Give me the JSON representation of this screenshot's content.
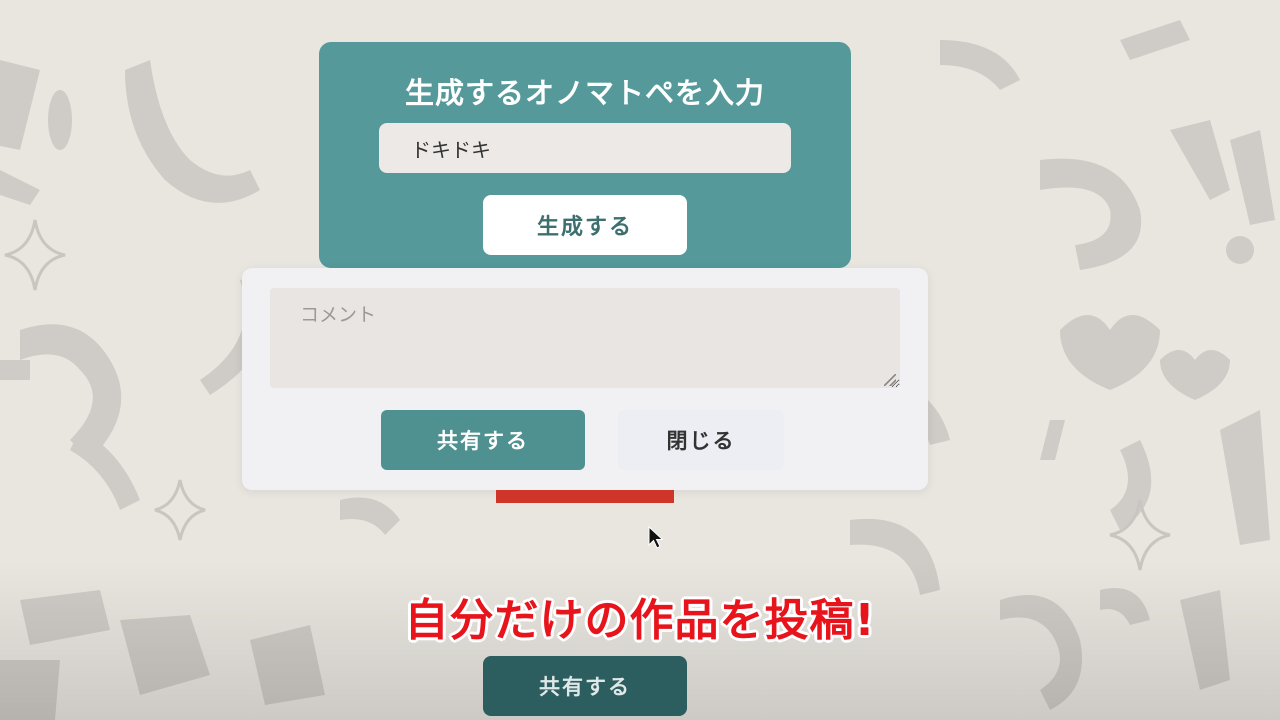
{
  "generator": {
    "title": "生成するオノマトペを入力",
    "input_value": "ドキドキ",
    "generate_label": "生成する"
  },
  "share_panel": {
    "comment_placeholder": "コメント",
    "share_label": "共有する",
    "close_label": "閉じる"
  },
  "caption": "自分だけの作品を投稿!",
  "bottom": {
    "share_label": "共有する"
  },
  "colors": {
    "card_teal": "#55999a",
    "share_teal": "#4f9090",
    "bottom_button": "#2c5d5f",
    "caption_red": "#e8141b",
    "accent_red": "#d0352a"
  }
}
